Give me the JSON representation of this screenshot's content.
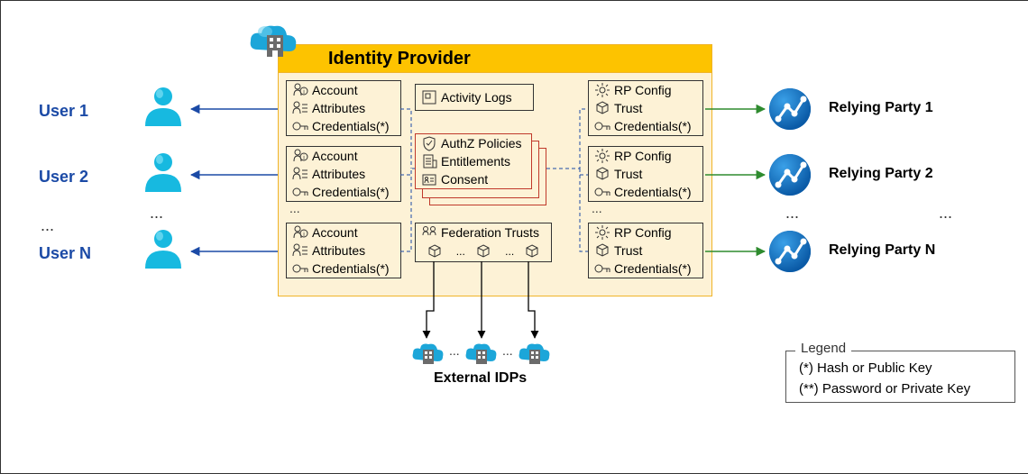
{
  "users": [
    {
      "label": "User 1"
    },
    {
      "label": "User 2"
    },
    {
      "label": "User N"
    }
  ],
  "users_ellipsis": "...",
  "idp": {
    "title": "Identity Provider",
    "account_block": {
      "row1": "Account",
      "row2": "Attributes",
      "row3": "Credentials(*)"
    },
    "account_ellipsis": "...",
    "activity_logs": "Activity Logs",
    "authz_block": {
      "row1": "AuthZ Policies",
      "row2": "Entitlements",
      "row3": "Consent"
    },
    "federation": {
      "title": "Federation Trusts"
    },
    "rp_block": {
      "row1": "RP Config",
      "row2": "Trust",
      "row3": "Credentials(*)"
    },
    "rp_ellipsis": "..."
  },
  "rps": [
    {
      "label": "Relying Party 1"
    },
    {
      "label": "Relying Party 2"
    },
    {
      "label": "Relying Party N"
    }
  ],
  "rps_ellipsis": "...",
  "external_idps": {
    "label": "External IDPs",
    "ellipsis": "..."
  },
  "legend": {
    "title": "Legend",
    "star1": "(*) Hash or Public Key",
    "star2": "(**) Password or Private Key"
  }
}
